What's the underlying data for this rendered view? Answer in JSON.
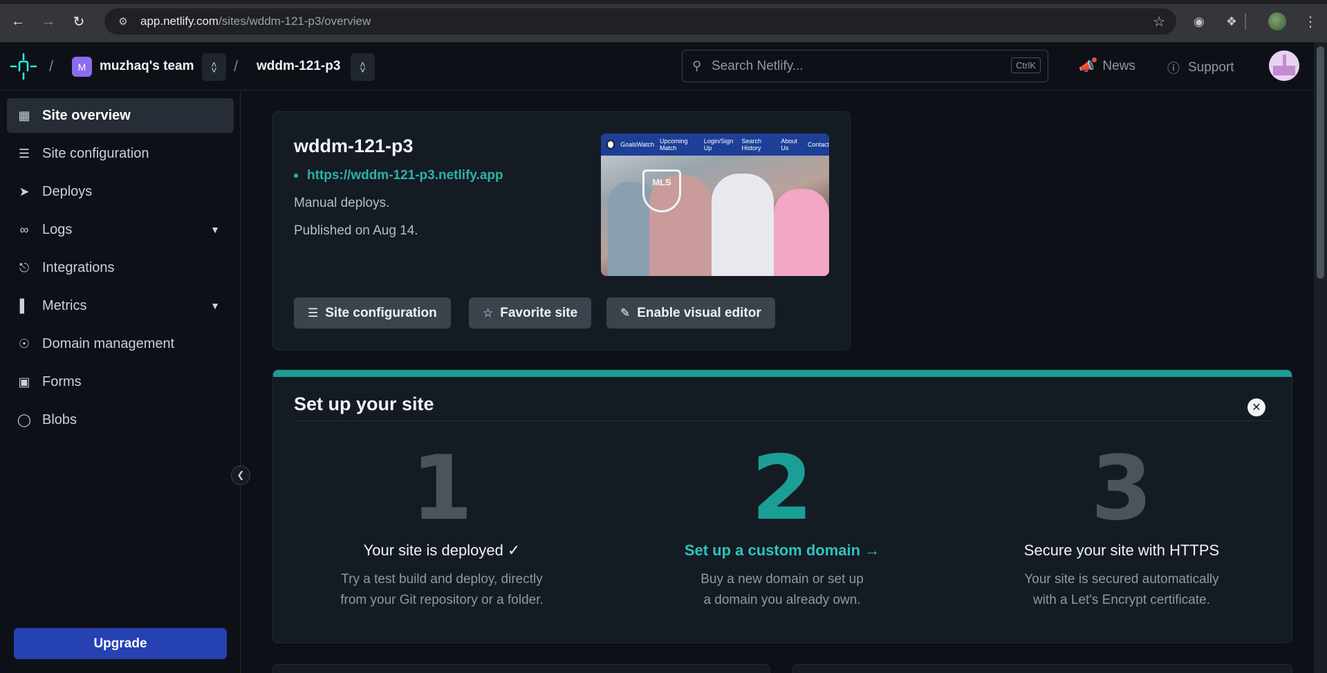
{
  "browser": {
    "url_host": "app.netlify.com",
    "url_path": "/sites/wddm-121-p3/overview"
  },
  "header": {
    "team_initial": "M",
    "team_name": "muzhaq's team",
    "site_name": "wddm-121-p3",
    "search_placeholder": "Search Netlify...",
    "search_shortcut": "CtrlK",
    "news_label": "News",
    "support_label": "Support"
  },
  "sidebar": {
    "items": [
      {
        "label": "Site overview",
        "icon": "grid-icon",
        "active": true
      },
      {
        "label": "Site configuration",
        "icon": "server-icon"
      },
      {
        "label": "Deploys",
        "icon": "rocket-icon"
      },
      {
        "label": "Logs",
        "icon": "logs-icon",
        "expandable": true
      },
      {
        "label": "Integrations",
        "icon": "plug-icon"
      },
      {
        "label": "Metrics",
        "icon": "bar-chart-icon",
        "expandable": true
      },
      {
        "label": "Domain management",
        "icon": "globe-icon"
      },
      {
        "label": "Forms",
        "icon": "form-icon"
      },
      {
        "label": "Blobs",
        "icon": "blob-icon"
      }
    ],
    "upgrade_label": "Upgrade"
  },
  "site_card": {
    "title": "wddm-121-p3",
    "url": "https://wddm-121-p3.netlify.app",
    "deploy_mode": "Manual deploys.",
    "published": "Published on Aug 14.",
    "preview_nav": [
      "GoalsWatch",
      "Upcoming Match",
      "Login/Sign Up",
      "Search History",
      "About Us",
      "Contact"
    ],
    "preview_badge": "MLS",
    "buttons": {
      "site_configuration": "Site configuration",
      "favorite": "Favorite site",
      "visual_editor": "Enable visual editor"
    }
  },
  "setup": {
    "heading": "Set up your site",
    "accent_color": "#1a9e96",
    "steps": [
      {
        "num": "1",
        "title": "Your site is deployed ✓",
        "desc1": "Try a test build and deploy, directly",
        "desc2": "from your Git repository or a folder."
      },
      {
        "num": "2",
        "title": "Set up a custom domain →",
        "desc1": "Buy a new domain or set up",
        "desc2": "a domain you already own."
      },
      {
        "num": "3",
        "title": "Secure your site with HTTPS",
        "desc1": "Your site is secured automatically",
        "desc2": "with a Let's Encrypt certificate."
      }
    ]
  }
}
